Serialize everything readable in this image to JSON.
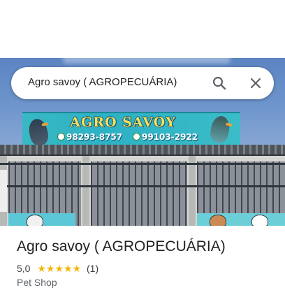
{
  "search": {
    "query": "Agro savoy ( AGROPECUÁRIA)",
    "search_icon": "search-icon",
    "close_icon": "close-icon"
  },
  "photo": {
    "sign_title": "AGRO SAVOY",
    "phone_1": "98293-8757",
    "phone_2": "99103-2922"
  },
  "place": {
    "name": "Agro savoy ( AGROPECUÁRIA)",
    "rating": "5,0",
    "stars": "★★★★★",
    "review_count": "(1)",
    "category": "Pet Shop"
  },
  "colors": {
    "star": "#f5b400",
    "text_primary": "#202124",
    "text_secondary": "#5f6368"
  }
}
